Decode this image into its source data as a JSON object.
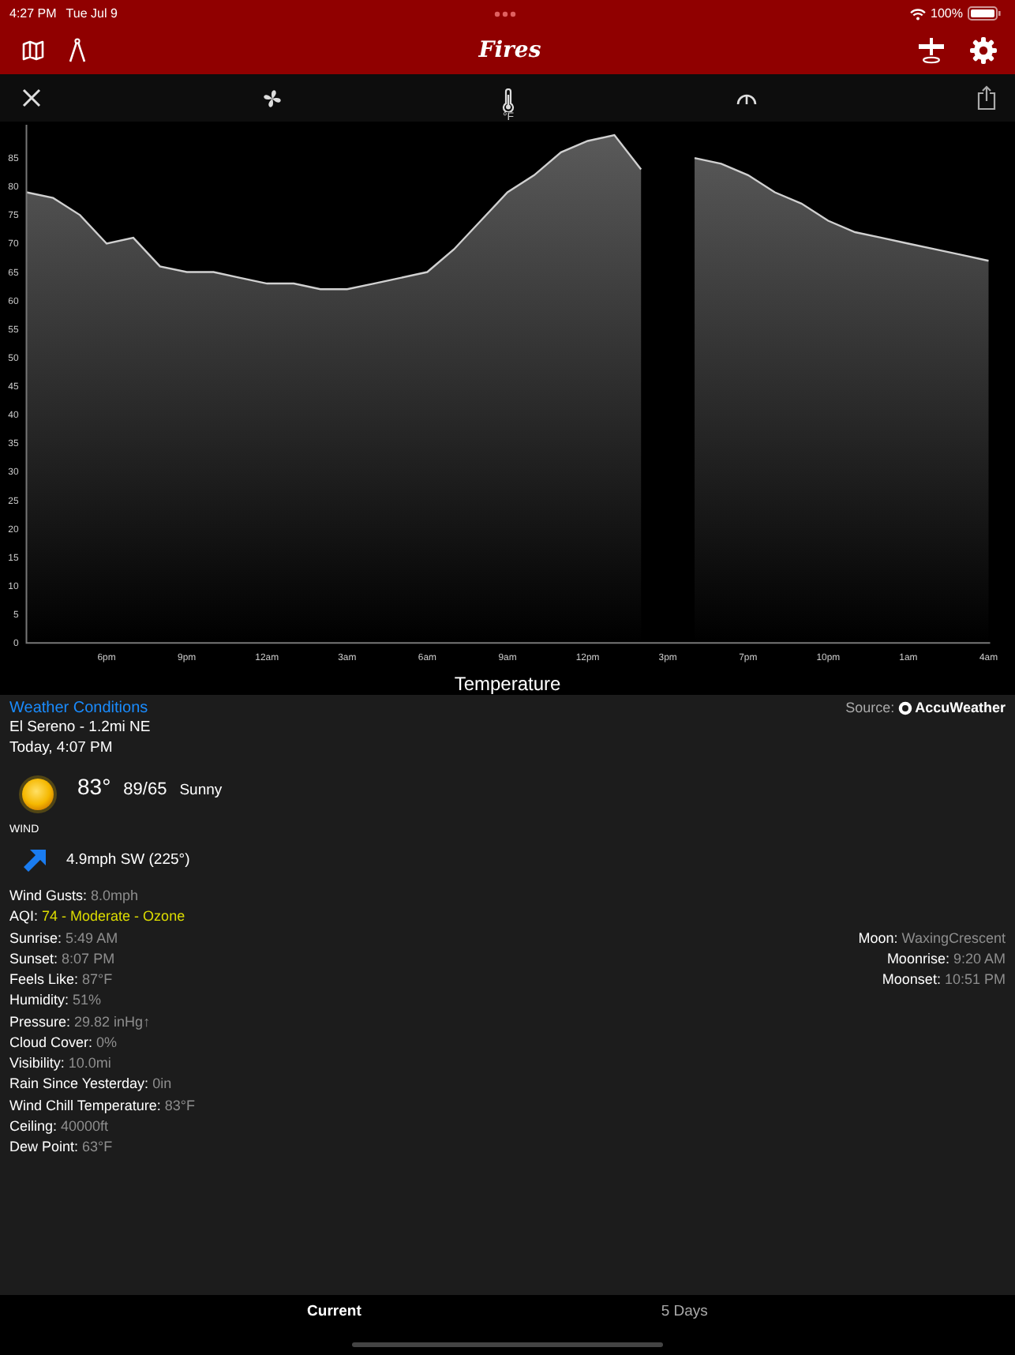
{
  "status_bar": {
    "time": "4:27 PM",
    "date": "Tue Jul 9",
    "battery": "100%"
  },
  "nav_bar": {
    "title": "Fires"
  },
  "toolbar": {
    "unit": "°F"
  },
  "chart": {
    "chart_data": {
      "type": "area",
      "title": "Temperature",
      "categories": [
        null,
        null,
        null,
        "6pm",
        null,
        null,
        "9pm",
        null,
        null,
        "12am",
        null,
        null,
        "3am",
        null,
        null,
        "6am",
        null,
        null,
        "9am",
        null,
        null,
        "12pm",
        null,
        null,
        "3pm",
        null,
        null,
        "7pm",
        null,
        null,
        "10pm",
        null,
        null,
        "1am",
        null,
        null,
        "4am"
      ],
      "series": [
        {
          "color": "#d0d0d0",
          "values": [
            79,
            78,
            75,
            70,
            71,
            66,
            65,
            65,
            64,
            63,
            63,
            62,
            62,
            63,
            64,
            65,
            69,
            74,
            79,
            82,
            86,
            88,
            89,
            83,
            null,
            85,
            84,
            82,
            79,
            77,
            74,
            72,
            71,
            70,
            69,
            68,
            67
          ]
        }
      ],
      "ylim": [
        0,
        90
      ],
      "yticks": [
        0,
        5,
        10,
        15,
        20,
        25,
        30,
        35,
        40,
        45,
        50,
        55,
        60,
        65,
        70,
        75,
        80,
        85
      ]
    }
  },
  "conditions": {
    "title": "Weather Conditions",
    "source_label": "Source:",
    "source_name": "AccuWeather",
    "location": "El Sereno - 1.2mi NE",
    "time": "Today, 4:07 PM",
    "temperature": "83°",
    "high_low": "89/65",
    "condition": "Sunny",
    "wind_label": "WIND",
    "wind": "4.9mph SW (225°)",
    "details": [
      {
        "label": "Wind Gusts:",
        "value": "8.0mph",
        "color": "#8e8e8e"
      },
      {
        "label": "AQI:",
        "value": "74 - Moderate - Ozone",
        "color": "#dcdc00"
      },
      {
        "label": "Sunrise:",
        "value": "5:49 AM",
        "color": "#8e8e8e"
      },
      {
        "label": "Sunset:",
        "value": "8:07 PM",
        "color": "#8e8e8e"
      },
      {
        "label": "Feels Like:",
        "value": "87°F",
        "color": "#8e8e8e"
      },
      {
        "label": "Humidity:",
        "value": "51%",
        "color": "#8e8e8e"
      },
      {
        "label": "Pressure:",
        "value": "29.82 inHg↑",
        "color": "#8e8e8e"
      },
      {
        "label": "Cloud Cover:",
        "value": "0%",
        "color": "#8e8e8e"
      },
      {
        "label": "Visibility:",
        "value": "10.0mi",
        "color": "#8e8e8e"
      },
      {
        "label": "Rain Since Yesterday:",
        "value": "0in",
        "color": "#8e8e8e"
      },
      {
        "label": "Wind Chill Temperature:",
        "value": "83°F",
        "color": "#8e8e8e"
      },
      {
        "label": "Ceiling:",
        "value": "40000ft",
        "color": "#8e8e8e"
      },
      {
        "label": "Dew Point:",
        "value": "63°F",
        "color": "#8e8e8e"
      }
    ],
    "moon": [
      {
        "label": "Moon:",
        "value": "WaxingCrescent"
      },
      {
        "label": "Moonrise:",
        "value": "9:20 AM"
      },
      {
        "label": "Moonset:",
        "value": "10:51 PM"
      }
    ]
  },
  "tabs": [
    {
      "label": "Current",
      "selected": true
    },
    {
      "label": "5 Days",
      "selected": false
    }
  ]
}
